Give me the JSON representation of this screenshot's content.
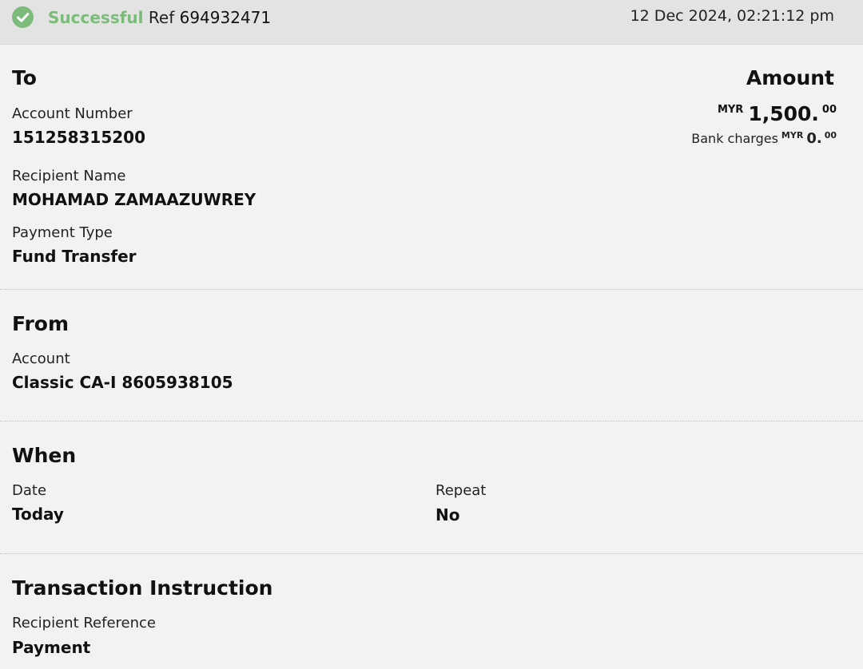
{
  "status": {
    "icon": "check-circle-icon",
    "icon_color": "#7dbb7d",
    "label": "Successful",
    "ref_label": "Ref",
    "ref_number": "694932471",
    "datetime": "12 Dec 2024, 02:21:12 pm"
  },
  "to": {
    "heading": "To",
    "account_number_label": "Account Number",
    "account_number": "151258315200",
    "recipient_name_label": "Recipient Name",
    "recipient_name": "MOHAMAD ZAMAAZUWREY",
    "payment_type_label": "Payment Type",
    "payment_type": "Fund Transfer"
  },
  "amount": {
    "heading": "Amount",
    "currency": "MYR",
    "value": "1,500.",
    "cents": "00",
    "bank_charges_label": "Bank charges",
    "bank_charges_currency": "MYR",
    "bank_charges_value": "0.",
    "bank_charges_cents": "00"
  },
  "from": {
    "heading": "From",
    "account_label": "Account",
    "account": "Classic CA-I 8605938105"
  },
  "when": {
    "heading": "When",
    "date_label": "Date",
    "date": "Today",
    "repeat_label": "Repeat",
    "repeat": "No"
  },
  "instruction": {
    "heading": "Transaction Instruction",
    "recipient_reference_label": "Recipient Reference",
    "recipient_reference": "Payment"
  }
}
